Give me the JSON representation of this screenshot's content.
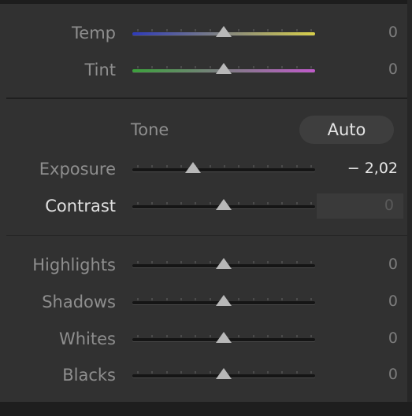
{
  "colors": {
    "temp_gradient": [
      "#2f3bb8",
      "#d7cf4a"
    ],
    "tint_gradient": [
      "#3ca13c",
      "#c05acb"
    ],
    "track_dark": "#151515",
    "thumb": "#b8b8b8"
  },
  "sliders": {
    "temp": {
      "label": "Temp",
      "value": "0",
      "level": 0.5
    },
    "tint": {
      "label": "Tint",
      "value": "0",
      "level": 0.5
    },
    "exposure": {
      "label": "Exposure",
      "value": "− 2,02",
      "level": 0.33
    },
    "contrast": {
      "label": "Contrast",
      "value": "0",
      "level": 0.5
    },
    "highlights": {
      "label": "Highlights",
      "value": "0",
      "level": 0.5
    },
    "shadows": {
      "label": "Shadows",
      "value": "0",
      "level": 0.5
    },
    "whites": {
      "label": "Whites",
      "value": "0",
      "level": 0.5
    },
    "blacks": {
      "label": "Blacks",
      "value": "0",
      "level": 0.5
    }
  },
  "tone": {
    "title": "Tone",
    "auto_label": "Auto"
  }
}
